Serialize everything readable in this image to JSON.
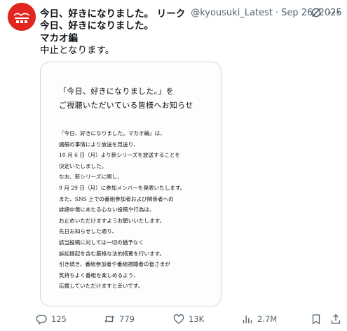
{
  "tweet": {
    "display_name": "今日、好きになりました。 リーク",
    "handle": "@kyousuki_Latest",
    "separator": "·",
    "date": "Sep 26, 2025",
    "text_lines": [
      "今日、好きになりました。",
      "マカオ編",
      "中止となります。"
    ]
  },
  "notice": {
    "title_lines": [
      "「今日、好きになりました。」を",
      "ご視聴いただいている皆様へお知らせ"
    ],
    "body_lines": [
      "『今日、好きになりました。マカオ編』は、",
      "諸般の事情により放送を見送り、",
      "10 月 6 日（月）より新シリーズを放送することを",
      "決定いたしました。",
      "なお、新シリーズに関し、",
      "9 月 29 日（月）に参加メンバーを発表いたします。",
      "また、SNS 上での番組参加者および関係者への",
      "誹謗中傷にあたる心ない投稿や行為は、",
      "お止めいただけますようお願いいたします。",
      "先日お知らせした通り、",
      "該当投稿に対しては一切の猶予なく",
      "訴訟提起を含む厳格な法的措置を行います。",
      "引き続き、番組参加者や番組視聴者の皆さまが",
      "気持ちよく番組を楽しめるよう、",
      "応援していただけますと幸いです。"
    ]
  },
  "actions": {
    "replies": "125",
    "reposts": "779",
    "likes": "13K",
    "views": "2.7M"
  },
  "icons": {
    "reply": "reply-icon",
    "repost": "repost-icon",
    "like": "heart-icon",
    "views": "views-icon",
    "bookmark": "bookmark-icon",
    "share": "share-icon",
    "grok": "grok-icon",
    "more": "more-icon"
  },
  "colors": {
    "avatar_bg": "#e0261f",
    "muted": "#536471",
    "border": "#cfd9de"
  }
}
